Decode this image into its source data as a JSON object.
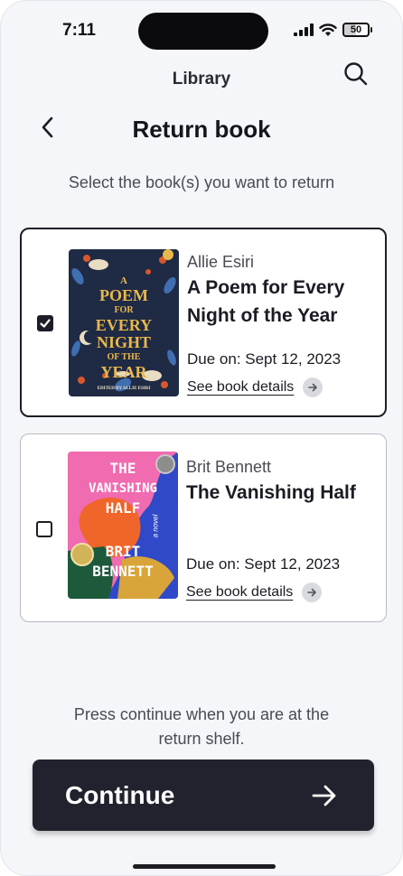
{
  "status_bar": {
    "time": "7:11",
    "battery": "50",
    "battery_level": 0.5
  },
  "header": {
    "section": "Library",
    "title": "Return book"
  },
  "instructions": "Select the book(s) you want to return",
  "books": [
    {
      "author": "Allie Esiri",
      "title": "A Poem for Every Night of the Year",
      "due": "Due on: Sept 12, 2023",
      "details_label": "See book details",
      "selected": true,
      "cover": {
        "colors": {
          "bg": "#1f2a44",
          "text": "#e9b84c",
          "accent": "#d9572c"
        },
        "lines": [
          "A",
          "POEM",
          "FOR",
          "EVERY",
          "NIGHT",
          "OF THE",
          "YEAR"
        ],
        "editor": "EDITED BY ALLIE ESIRI"
      }
    },
    {
      "author": "Brit Bennett",
      "title": "The Vanishing Half",
      "due": "Due on: Sept 12, 2023",
      "details_label": "See book details",
      "selected": false,
      "cover": {
        "colors": {
          "pink": "#f06bb0",
          "blue": "#2f49c8",
          "orange": "#f0652a",
          "green": "#1d5a3c"
        },
        "lines": [
          "THE",
          "VANISHING",
          "HALF",
          "BRIT",
          "BENNETT"
        ],
        "tagline": "a novel"
      }
    }
  ],
  "footer_note": "Press continue when you are at the return shelf.",
  "continue_label": "Continue"
}
